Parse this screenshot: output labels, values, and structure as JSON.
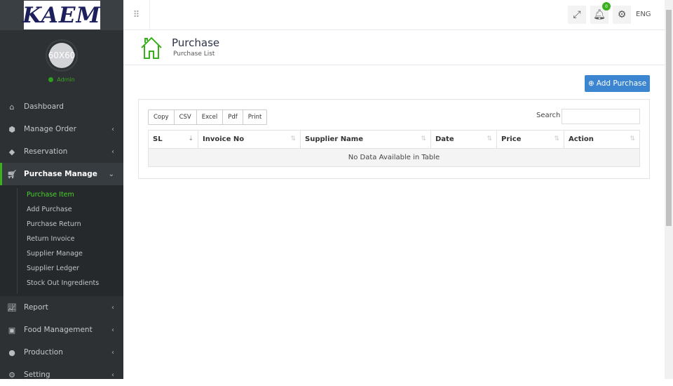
{
  "brand": {
    "logo_text": "KAEM",
    "avatar_text": "60X60",
    "role": "Admin"
  },
  "sidebar": {
    "items": [
      {
        "label": "Dashboard",
        "icon": "home-icon"
      },
      {
        "label": "Manage Order",
        "icon": "cube-icon"
      },
      {
        "label": "Reservation",
        "icon": "tag-icon"
      },
      {
        "label": "Purchase Manage",
        "icon": "cart-icon"
      },
      {
        "label": "Report",
        "icon": "chart-line-icon"
      },
      {
        "label": "Food Management",
        "icon": "food-box-icon"
      },
      {
        "label": "Production",
        "icon": "production-icon"
      },
      {
        "label": "Setting",
        "icon": "gear-icon"
      }
    ],
    "submenu": [
      "Purchase Item",
      "Add Purchase",
      "Purchase Return",
      "Return Invoice",
      "Supplier Manage",
      "Supplier Ledger",
      "Stock Out Ingredients"
    ]
  },
  "topbar": {
    "notification_count": "0",
    "language": "ENG"
  },
  "page": {
    "title": "Purchase",
    "subtitle": "Purchase List",
    "add_button": "Add Purchase"
  },
  "table": {
    "export_buttons": [
      "Copy",
      "CSV",
      "Excel",
      "Pdf",
      "Print"
    ],
    "search_label": "Search",
    "search_value": "",
    "columns": [
      "SL",
      "Invoice No",
      "Supplier Name",
      "Date",
      "Price",
      "Action"
    ],
    "empty_text": "No Data Available in Table"
  },
  "colors": {
    "accent": "#3bb01f",
    "primary": "#3c85d0",
    "sidebar": "#2d3134"
  }
}
